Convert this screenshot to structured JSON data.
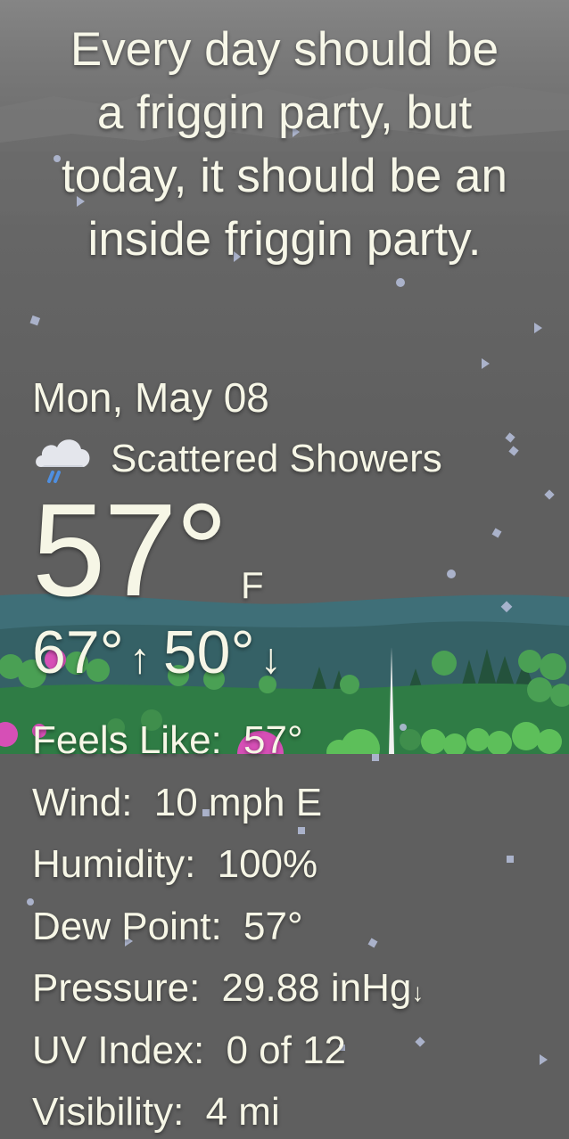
{
  "quote": "Every day should be\na friggin party, but\ntoday, it should be an\ninside friggin party.",
  "date": "Mon, May 08",
  "conditions": {
    "icon": "rain-cloud-icon",
    "label": "Scattered Showers"
  },
  "current": {
    "temperature": "57°",
    "unit": "F"
  },
  "high_low": {
    "high": "67°",
    "high_arrow": "↑",
    "low": "50°",
    "low_arrow": "↓"
  },
  "details": [
    {
      "label": "Feels Like:",
      "value": "57°",
      "trend": ""
    },
    {
      "label": "Wind:",
      "value": "10 mph E",
      "trend": ""
    },
    {
      "label": "Humidity:",
      "value": "100%",
      "trend": ""
    },
    {
      "label": "Dew Point:",
      "value": "57°",
      "trend": ""
    },
    {
      "label": "Pressure:",
      "value": "29.88 inHg",
      "trend": "↓"
    },
    {
      "label": "UV Index:",
      "value": "0 of 12",
      "trend": ""
    },
    {
      "label": "Visibility:",
      "value": "4 mi",
      "trend": ""
    }
  ],
  "colors": {
    "sky": "#5f5f5f",
    "text": "#f6f6e6",
    "hills": "#3e6a72",
    "grass": "#2f8a4a",
    "blossom": "#d84fb8",
    "rain": "#a9b4d6"
  }
}
